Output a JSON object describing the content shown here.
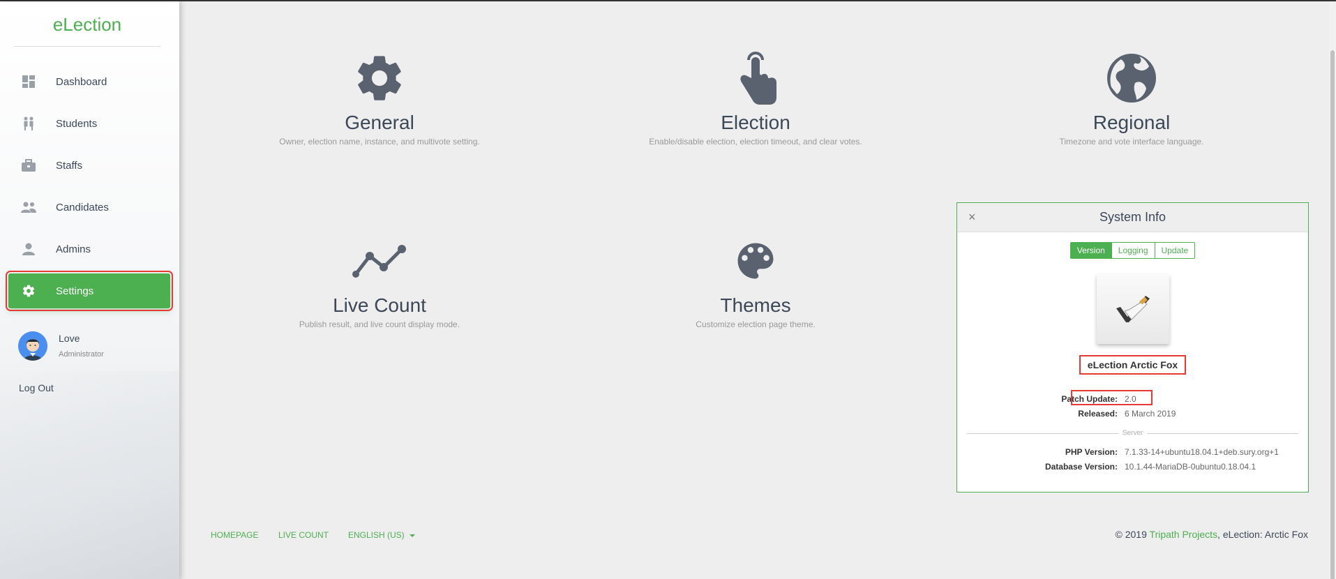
{
  "brand": "eLection",
  "nav": [
    {
      "label": "Dashboard",
      "icon": "dashboard-icon"
    },
    {
      "label": "Students",
      "icon": "students-icon"
    },
    {
      "label": "Staffs",
      "icon": "briefcase-icon"
    },
    {
      "label": "Candidates",
      "icon": "group-icon"
    },
    {
      "label": "Admins",
      "icon": "person-icon"
    },
    {
      "label": "Settings",
      "icon": "gear-icon",
      "active": true
    }
  ],
  "user": {
    "name": "Love",
    "role": "Administrator"
  },
  "logout": "Log Out",
  "tiles": [
    {
      "title": "General",
      "desc": "Owner, election name, instance, and multivote setting.",
      "icon": "gear-icon"
    },
    {
      "title": "Election",
      "desc": "Enable/disable election, election timeout, and clear votes.",
      "icon": "pointer-hand-icon"
    },
    {
      "title": "Regional",
      "desc": "Timezone and vote interface language.",
      "icon": "globe-icon"
    },
    {
      "title": "Live Count",
      "desc": "Publish result, and live count display mode.",
      "icon": "line-chart-icon"
    },
    {
      "title": "Themes",
      "desc": "Customize election page theme.",
      "icon": "palette-icon"
    }
  ],
  "sysinfo": {
    "title": "System Info",
    "close": "×",
    "tabs": [
      "Version",
      "Logging",
      "Update"
    ],
    "product": "eLection Arctic Fox",
    "patch_label": "Patch Update:",
    "patch_value": "2.0",
    "released_label": "Released:",
    "released_value": "6 March 2019",
    "server_label": "Server",
    "php_label": "PHP Version:",
    "php_value": "7.1.33-14+ubuntu18.04.1+deb.sury.org+1",
    "db_label": "Database Version:",
    "db_value": "10.1.44-MariaDB-0ubuntu0.18.04.1"
  },
  "footer": {
    "homepage": "HOMEPAGE",
    "live_count": "LIVE COUNT",
    "language": "ENGLISH (US)",
    "copyright_prefix": "© 2019 ",
    "copyright_link": "Tripath Projects",
    "copyright_suffix": ", eLection: Arctic Fox"
  },
  "colors": {
    "accent": "#4caf50",
    "highlight": "#e53935",
    "icon": "#5a6270"
  }
}
